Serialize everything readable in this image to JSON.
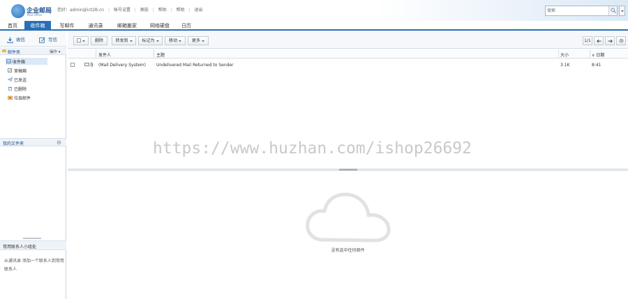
{
  "header": {
    "logo_title": "企业邮局",
    "logo_sub": "Post Office",
    "user_links": [
      "您好：admin@ict2B.cn",
      "|",
      "帐号设置",
      "|",
      "换肤",
      "|",
      "帮助",
      "|",
      "帮助",
      "|",
      "退出"
    ],
    "search_placeholder": "搜索"
  },
  "nav": {
    "tabs": [
      "首页",
      "收件箱",
      "写邮件",
      "通讯录",
      "邮箱搬家",
      "网络硬盘",
      "日历"
    ]
  },
  "sidebar": {
    "receive_label": "收信",
    "compose_label": "写信",
    "mailbox_label": "邮件夹",
    "actions_label": "操作",
    "folders": [
      "收件箱",
      "草稿箱",
      "已发送",
      "已删除",
      "垃圾邮件"
    ],
    "my_folders_label": "我的文件夹",
    "contacts_label": "常用联系人小组处",
    "contacts_hint": "从通讯录 添加一个联系人到常用联系人"
  },
  "toolbar": {
    "delete_label": "删除",
    "forward_label": "转发到",
    "mark_label": "标记为",
    "move_label": "移动",
    "more_label": "更多",
    "page_label": "1/1"
  },
  "list": {
    "col_sender": "发件人",
    "col_subject": "主题",
    "col_size": "大小",
    "col_date": "日期",
    "rows": [
      {
        "sender": "(Mail Delivery System)",
        "subject": "Undelivered Mail Returned to Sender",
        "size": "3.1K",
        "date": "8:41"
      }
    ]
  },
  "watermark": "https://www.huzhan.com/ishop26692",
  "preview": {
    "empty_text": "没有选中任何邮件"
  },
  "colors": {
    "accent": "#2a6fb5",
    "header_gradient_end": "#dbe9f6"
  }
}
